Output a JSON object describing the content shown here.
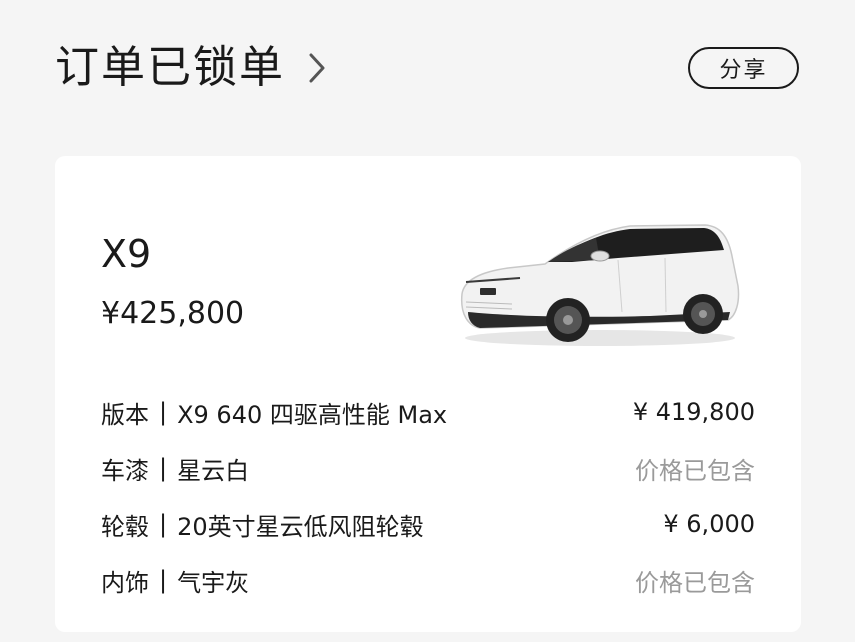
{
  "header": {
    "title": "订单已锁单",
    "share_label": "分享"
  },
  "card": {
    "model_name": "X9",
    "model_price": "¥425,800",
    "specs": [
      {
        "label": "版本",
        "separator": "|",
        "value": "X9 640 四驱高性能 Max",
        "price": "¥ 419,800",
        "price_muted": false
      },
      {
        "label": "车漆",
        "separator": "|",
        "value": "星云白",
        "price": "价格已包含",
        "price_muted": true
      },
      {
        "label": "轮毂",
        "separator": "|",
        "value": "20英寸星云低风阻轮毂",
        "price": "¥ 6,000",
        "price_muted": false
      },
      {
        "label": "内饰",
        "separator": "|",
        "value": "气宇灰",
        "price": "价格已包含",
        "price_muted": true
      }
    ]
  },
  "colors": {
    "background": "#f5f5f5",
    "card": "#ffffff",
    "text": "#1a1a1a",
    "muted": "#9a9a9a"
  },
  "icons": {
    "title_chevron": "chevron-right-icon",
    "car": "car-image"
  }
}
